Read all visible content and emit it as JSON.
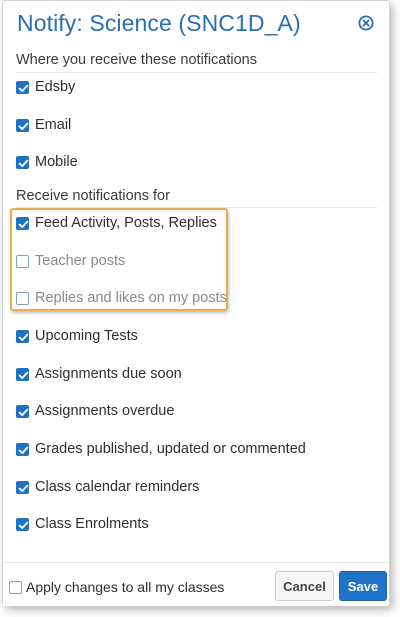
{
  "dialog": {
    "title": "Notify: Science (SNC1D_A)",
    "close_icon": "close-circle-icon"
  },
  "receive_section": {
    "label": "Where you receive these notifications",
    "items": [
      {
        "label": "Edsby",
        "checked": true,
        "disabled": false
      },
      {
        "label": "Email",
        "checked": true,
        "disabled": false
      },
      {
        "label": "Mobile",
        "checked": true,
        "disabled": false
      }
    ]
  },
  "notify_section": {
    "label": "Receive notifications for",
    "items": [
      {
        "label": "Feed Activity, Posts, Replies",
        "checked": true,
        "disabled": false
      },
      {
        "label": "Teacher posts",
        "checked": false,
        "disabled": true
      },
      {
        "label": "Replies and likes on my posts",
        "checked": false,
        "disabled": true
      },
      {
        "label": "Upcoming Tests",
        "checked": true,
        "disabled": false
      },
      {
        "label": "Assignments due soon",
        "checked": true,
        "disabled": false
      },
      {
        "label": "Assignments overdue",
        "checked": true,
        "disabled": false
      },
      {
        "label": "Grades published, updated or commented",
        "checked": true,
        "disabled": false
      },
      {
        "label": "Class calendar reminders",
        "checked": true,
        "disabled": false
      },
      {
        "label": "Class Enrolments",
        "checked": true,
        "disabled": false
      }
    ]
  },
  "footer": {
    "apply_all_label": "Apply changes to all my classes",
    "apply_all_checked": false,
    "cancel_label": "Cancel",
    "save_label": "Save"
  },
  "colors": {
    "accent": "#1d72c2",
    "title": "#2a6eb4",
    "highlight_border": "#efa84b"
  }
}
